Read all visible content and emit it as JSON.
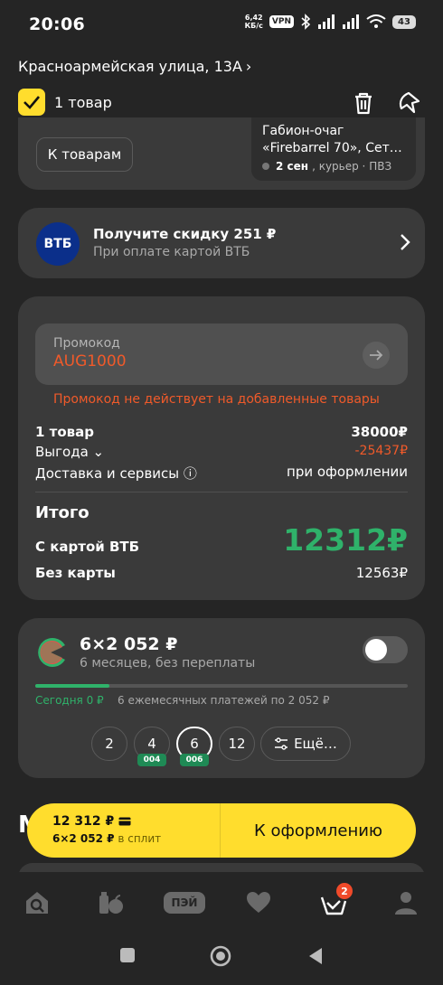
{
  "status": {
    "time": "20:06",
    "speed_value": "6,42",
    "speed_unit": "КБ/с",
    "vpn": "VPN",
    "battery": "43"
  },
  "header": {
    "address": "Красноармейская улица, 13А",
    "select_label": "1 товар"
  },
  "order_card": {
    "to_products_button": "К товарам",
    "product_name_line1": "Габион-очаг",
    "product_name_line2": "«Firebarrel 70», Сет…",
    "delivery_date": "2 сен",
    "delivery_method": ", курьер · ПВЗ"
  },
  "vtb_offer": {
    "logo_text": "ВТБ",
    "title": "Получите скидку 251 ₽",
    "subtitle": "При оплате картой ВТБ"
  },
  "summary": {
    "promo_label": "Промокод",
    "promo_value": "AUG1000",
    "promo_error": "Промокод не действует на добавленные товары",
    "items_label": "1 товар",
    "items_value": "38000₽",
    "benefit_label": "Выгода ⌄",
    "benefit_value": "-25437₽",
    "delivery_label": "Доставка и сервисы ⓘ",
    "delivery_value": "при оформлении",
    "total_title": "Итого",
    "with_card_label": "С картой ВТБ",
    "with_card_value": "12312₽",
    "without_card_label": "Без карты",
    "without_card_value": "12563₽"
  },
  "split": {
    "amount": "6×2 052 ₽",
    "subtitle": "6 месяцев, без переплаты",
    "today": "Сегодня 0 ₽",
    "payments": "6 ежемесячных платежей по 2 052 ₽",
    "progress_fraction": 0.2,
    "toggle_on": false,
    "options": [
      {
        "label": "2",
        "tag": ""
      },
      {
        "label": "4",
        "tag": "004"
      },
      {
        "label": "6",
        "tag": "006"
      },
      {
        "label": "12",
        "tag": ""
      }
    ],
    "more_label": "Ещё…"
  },
  "peek_text": "М",
  "checkout": {
    "price": "12 312 ₽",
    "split_amount": "6×2 052 ₽",
    "split_suffix": "в сплит",
    "action": "К оформлению"
  },
  "tabbar": {
    "pei_label": "ПЭЙ",
    "cart_badge": "2"
  },
  "colors": {
    "background": "#252525",
    "card": "#3a3a3a",
    "accent_yellow": "#ffdd2d",
    "error_orange": "#f05a2a",
    "success_green": "#2fb26a",
    "vtb_blue": "#0b2f8a"
  }
}
